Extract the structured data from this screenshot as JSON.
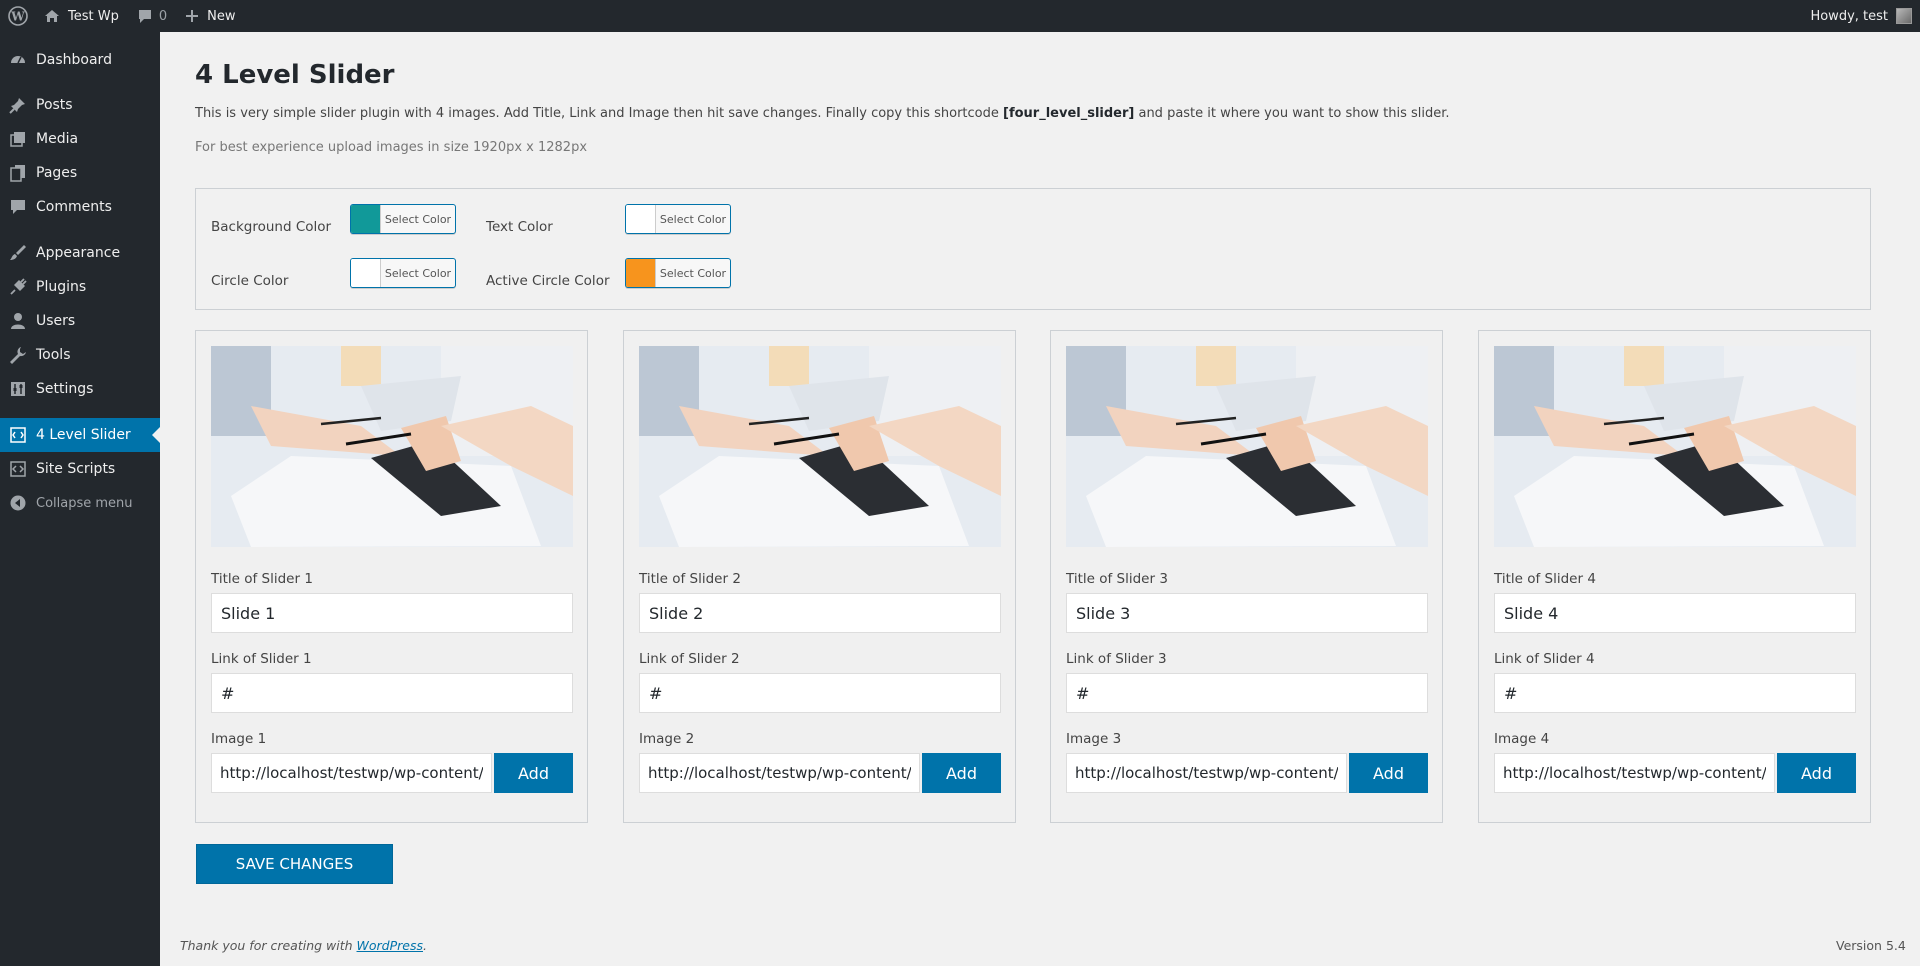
{
  "adminbar": {
    "site_name": "Test Wp",
    "comments_count": "0",
    "new_label": "New",
    "howdy": "Howdy, test"
  },
  "sidebar": {
    "items": [
      {
        "label": "Dashboard",
        "icon": "dashboard-icon"
      },
      {
        "label": "Posts",
        "icon": "pin-icon"
      },
      {
        "label": "Media",
        "icon": "media-icon"
      },
      {
        "label": "Pages",
        "icon": "pages-icon"
      },
      {
        "label": "Comments",
        "icon": "comment-icon"
      },
      {
        "label": "Appearance",
        "icon": "brush-icon"
      },
      {
        "label": "Plugins",
        "icon": "plug-icon"
      },
      {
        "label": "Users",
        "icon": "user-icon"
      },
      {
        "label": "Tools",
        "icon": "wrench-icon"
      },
      {
        "label": "Settings",
        "icon": "settings-icon"
      },
      {
        "label": "4 Level Slider",
        "icon": "slider-icon"
      },
      {
        "label": "Site Scripts",
        "icon": "script-icon"
      },
      {
        "label": "Collapse menu",
        "icon": "collapse-icon"
      }
    ]
  },
  "page": {
    "title": "4 Level Slider",
    "desc_before": "This is very simple slider plugin with 4 images. Add Title, Link and Image then hit save changes. Finally copy this shortcode ",
    "shortcode": "[four_level_slider]",
    "desc_after": " and paste it where you want to show this slider.",
    "size_hint": "For best experience upload images in size 1920px x 1282px"
  },
  "colors": {
    "select_label": "Select Color",
    "background_label": "Background Color",
    "background_value": "#119999",
    "text_label": "Text Color",
    "text_value": "#ffffff",
    "circle_label": "Circle Color",
    "circle_value": "#ffffff",
    "active_circle_label": "Active Circle Color",
    "active_circle_value": "#f7941d"
  },
  "slides": [
    {
      "title_label": "Title of Slider 1",
      "title_value": "Slide 1",
      "link_label": "Link of Slider 1",
      "link_value": "#",
      "image_label": "Image 1",
      "image_value": "http://localhost/testwp/wp-content/u"
    },
    {
      "title_label": "Title of Slider 2",
      "title_value": "Slide 2",
      "link_label": "Link of Slider 2",
      "link_value": "#",
      "image_label": "Image 2",
      "image_value": "http://localhost/testwp/wp-content/u"
    },
    {
      "title_label": "Title of Slider 3",
      "title_value": "Slide 3",
      "link_label": "Link of Slider 3",
      "link_value": "#",
      "image_label": "Image 3",
      "image_value": "http://localhost/testwp/wp-content/u"
    },
    {
      "title_label": "Title of Slider 4",
      "title_value": "Slide 4",
      "link_label": "Link of Slider 4",
      "link_value": "#",
      "image_label": "Image 4",
      "image_value": "http://localhost/testwp/wp-content/u"
    }
  ],
  "add_label": "Add",
  "save_label": "SAVE CHANGES",
  "footer": {
    "thanks_before": "Thank you for creating with ",
    "thanks_link": "WordPress",
    "thanks_after": ".",
    "version": "Version 5.4"
  }
}
